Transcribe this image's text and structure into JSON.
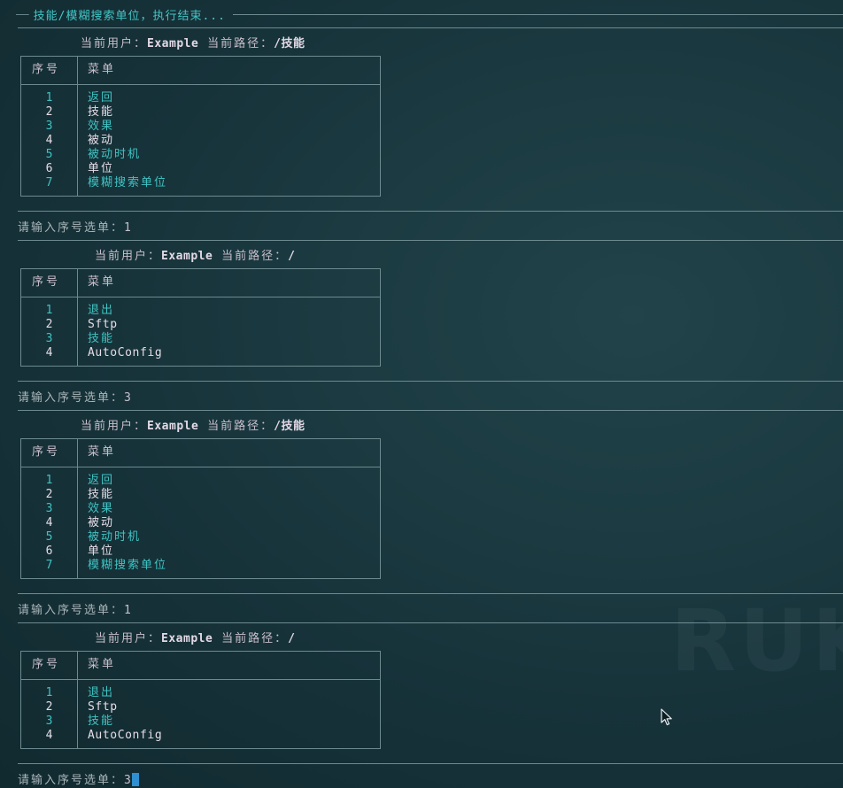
{
  "banner": {
    "text": "技能/模糊搜索单位，执行结束..."
  },
  "blocks": [
    {
      "header": {
        "user_label": "当前用户：",
        "user": "Example",
        "path_label": "当前路径：",
        "path": "/技能"
      },
      "columns": [
        "序号",
        "菜单"
      ],
      "items": [
        {
          "num": "1",
          "label": "返回"
        },
        {
          "num": "2",
          "label": "技能"
        },
        {
          "num": "3",
          "label": "效果"
        },
        {
          "num": "4",
          "label": "被动"
        },
        {
          "num": "5",
          "label": "被动时机"
        },
        {
          "num": "6",
          "label": "单位"
        },
        {
          "num": "7",
          "label": "模糊搜索单位"
        }
      ],
      "prompt": {
        "text": "请输入序号选单：",
        "value": "1"
      }
    },
    {
      "header": {
        "user_label": "当前用户：",
        "user": "Example",
        "path_label": "当前路径：",
        "path": "/"
      },
      "columns": [
        "序号",
        "菜单"
      ],
      "items": [
        {
          "num": "1",
          "label": "退出"
        },
        {
          "num": "2",
          "label": "Sftp"
        },
        {
          "num": "3",
          "label": "技能"
        },
        {
          "num": "4",
          "label": "AutoConfig"
        }
      ],
      "prompt": {
        "text": "请输入序号选单：",
        "value": "3"
      }
    },
    {
      "header": {
        "user_label": "当前用户：",
        "user": "Example",
        "path_label": "当前路径：",
        "path": "/技能"
      },
      "columns": [
        "序号",
        "菜单"
      ],
      "items": [
        {
          "num": "1",
          "label": "返回"
        },
        {
          "num": "2",
          "label": "技能"
        },
        {
          "num": "3",
          "label": "效果"
        },
        {
          "num": "4",
          "label": "被动"
        },
        {
          "num": "5",
          "label": "被动时机"
        },
        {
          "num": "6",
          "label": "单位"
        },
        {
          "num": "7",
          "label": "模糊搜索单位"
        }
      ],
      "prompt": {
        "text": "请输入序号选单：",
        "value": "1"
      }
    },
    {
      "header": {
        "user_label": "当前用户：",
        "user": "Example",
        "path_label": "当前路径：",
        "path": "/"
      },
      "columns": [
        "序号",
        "菜单"
      ],
      "items": [
        {
          "num": "1",
          "label": "退出"
        },
        {
          "num": "2",
          "label": "Sftp"
        },
        {
          "num": "3",
          "label": "技能"
        },
        {
          "num": "4",
          "label": "AutoConfig"
        }
      ],
      "prompt": {
        "text": "请输入序号选单：",
        "value": "3",
        "has_cursor": true
      }
    }
  ],
  "colors": {
    "background": "#163138",
    "accent_cyan": "#3fc3c3",
    "text_light": "#e6dde8",
    "rule": "#6c8a90",
    "cursor": "#2f8fd0"
  },
  "icons": [
    "mouse-pointer-icon"
  ],
  "watermark_text": "RUK"
}
